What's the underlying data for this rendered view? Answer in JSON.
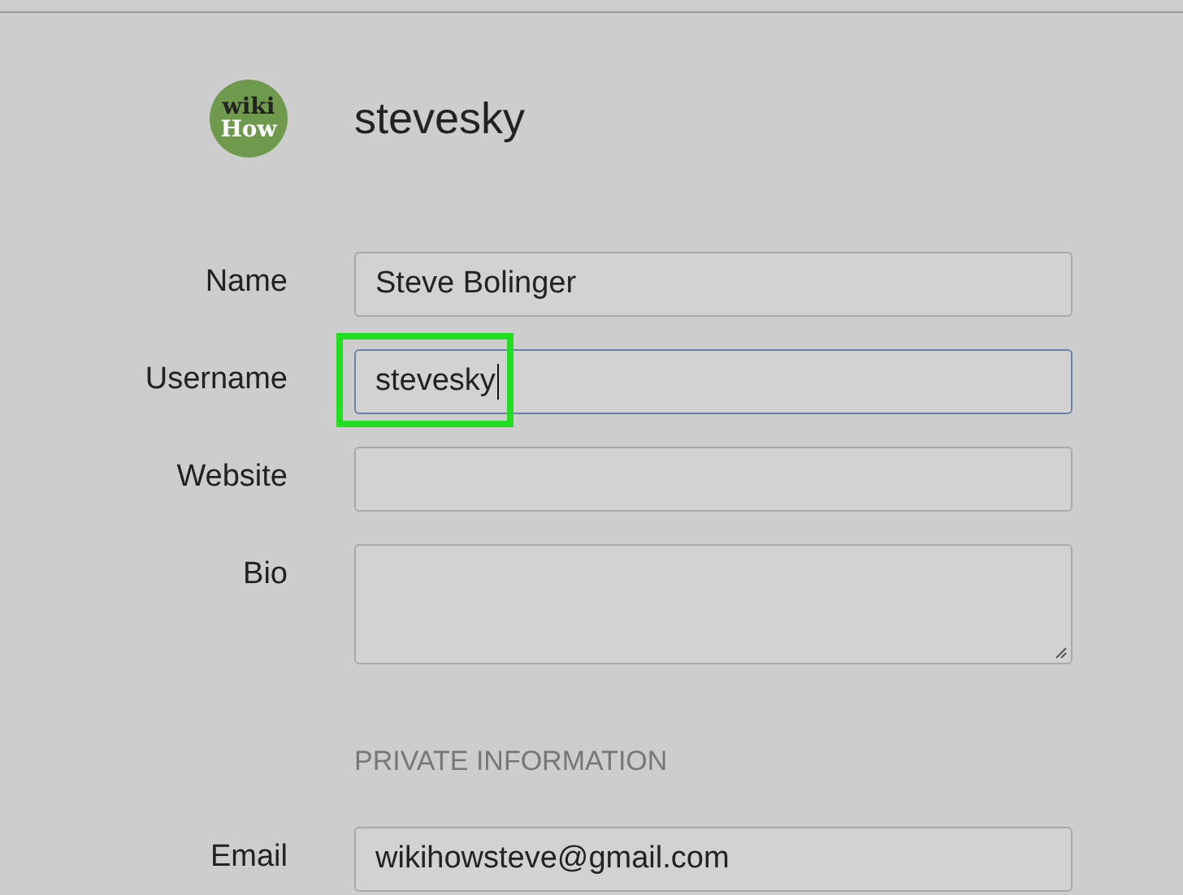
{
  "header": {
    "avatar_text": [
      "wiki",
      "How"
    ],
    "username": "stevesky"
  },
  "fields": [
    {
      "label": "Name",
      "value": "Steve Bolinger",
      "kind": "line",
      "focused": false,
      "highlighted": false
    },
    {
      "label": "Username",
      "value": "stevesky",
      "kind": "line",
      "focused": true,
      "highlighted": true
    },
    {
      "label": "Website",
      "kind": "line",
      "focused": false,
      "highlighted": false
    },
    {
      "label": "Bio",
      "kind": "multiline",
      "focused": false,
      "highlighted": false
    }
  ],
  "private_section": {
    "title": "PRIVATE INFORMATION",
    "fields": [
      {
        "label": "Email",
        "value": "wikihowsteve@gmail.com",
        "kind": "line",
        "focused": false,
        "highlighted": false
      }
    ]
  }
}
